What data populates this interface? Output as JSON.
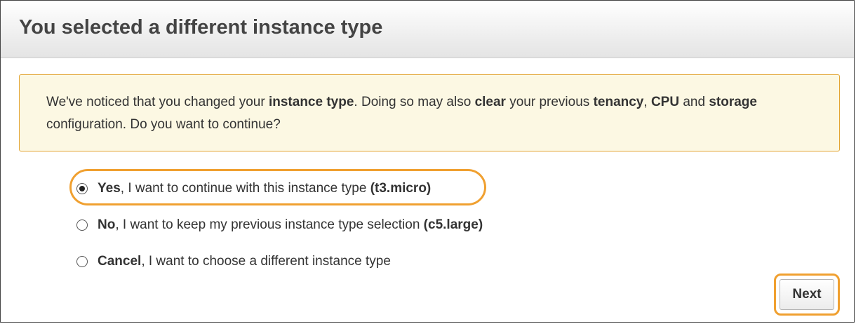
{
  "dialog": {
    "title": "You selected a different instance type"
  },
  "warning": {
    "p1": "We've noticed that you changed your ",
    "b1": "instance type",
    "p2": ". Doing so may also ",
    "b2": "clear",
    "p3": " your previous ",
    "b3": "tenancy",
    "p4": ", ",
    "b4": "CPU",
    "p5": " and ",
    "b5": "storage",
    "p6": " configuration. Do you want to continue?"
  },
  "options": [
    {
      "bold": "Yes",
      "text": ", I want to continue with this instance type ",
      "suffix": "(t3.micro)",
      "selected": true
    },
    {
      "bold": "No",
      "text": ", I want to keep my previous instance type selection ",
      "suffix": "(c5.large)",
      "selected": false
    },
    {
      "bold": "Cancel",
      "text": ", I want to choose a different instance type",
      "suffix": "",
      "selected": false
    }
  ],
  "buttons": {
    "next_label": "Next"
  },
  "colors": {
    "highlight": "#f0a030",
    "warning_bg": "#fcf8e3",
    "warning_border": "#e3a533"
  }
}
